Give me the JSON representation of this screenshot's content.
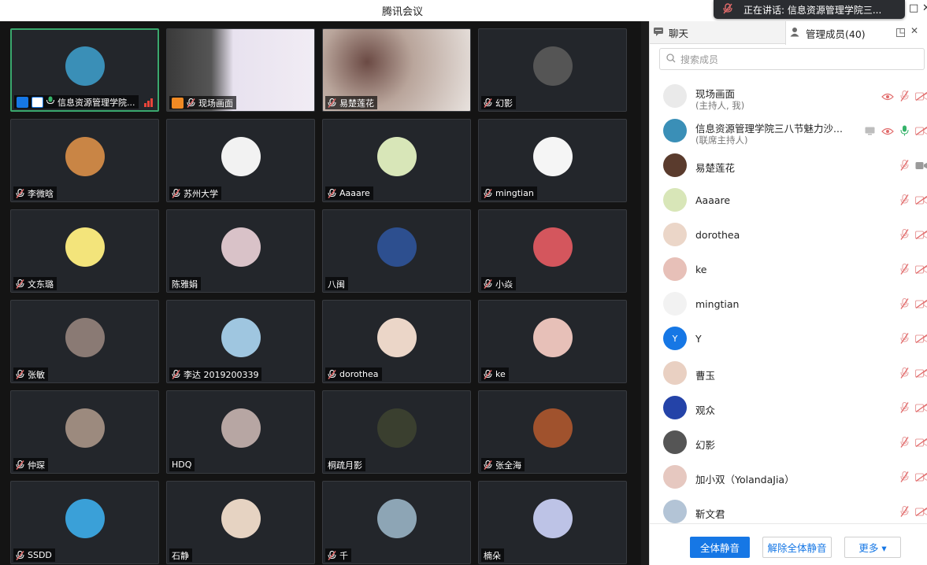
{
  "window": {
    "title": "腾讯会议",
    "speaking_banner": "正在讲话: 信息资源管理学院三..."
  },
  "grid": [
    {
      "name": "信息资源管理学院...",
      "muted": false,
      "active": true,
      "avatar_color": "#3a8fb7",
      "icon": "host-badges"
    },
    {
      "name": "现场画面",
      "muted": true,
      "active": false,
      "avatar_color": "#c9c9cf",
      "icon": "live-video"
    },
    {
      "name": "易楚莲花",
      "muted": true,
      "active": false,
      "avatar_color": "#b9a59b",
      "icon": "camera-video"
    },
    {
      "name": "幻影",
      "muted": true,
      "active": false,
      "avatar_color": "#555555"
    },
    {
      "name": "李微晗",
      "muted": true,
      "active": false,
      "avatar_color": "#c98545"
    },
    {
      "name": "苏州大学",
      "muted": true,
      "active": false,
      "avatar_color": "#f2f2f2"
    },
    {
      "name": "Aaaare",
      "muted": true,
      "active": false,
      "avatar_color": "#d8e6b8"
    },
    {
      "name": "mingtian",
      "muted": true,
      "active": false,
      "avatar_color": "#f5f5f5"
    },
    {
      "name": "文东璐",
      "muted": true,
      "active": false,
      "avatar_color": "#f3e47b"
    },
    {
      "name": "陈雅娟",
      "muted": false,
      "active": false,
      "avatar_color": "#d9c2c8"
    },
    {
      "name": "八闽",
      "muted": false,
      "active": false,
      "avatar_color": "#2d4f8f"
    },
    {
      "name": "小焱",
      "muted": true,
      "active": false,
      "avatar_color": "#d4565d"
    },
    {
      "name": "张敏",
      "muted": true,
      "active": false,
      "avatar_color": "#8a7a74"
    },
    {
      "name": "李达 2019200339",
      "muted": true,
      "active": false,
      "avatar_color": "#9fc6e0"
    },
    {
      "name": "dorothea",
      "muted": true,
      "active": false,
      "avatar_color": "#ebd6c8"
    },
    {
      "name": "ke",
      "muted": true,
      "active": false,
      "avatar_color": "#e7c0b8"
    },
    {
      "name": "仲琛",
      "muted": true,
      "active": false,
      "avatar_color": "#9c8a7e"
    },
    {
      "name": "HDQ",
      "muted": false,
      "active": false,
      "avatar_color": "#b7a6a3"
    },
    {
      "name": "桐疏月影",
      "muted": false,
      "active": false,
      "avatar_color": "#3a3f2f"
    },
    {
      "name": "张全海",
      "muted": true,
      "active": false,
      "avatar_color": "#a0522d"
    },
    {
      "name": "SSDD",
      "muted": true,
      "active": false,
      "avatar_color": "#3aa0d8"
    },
    {
      "name": "石静",
      "muted": false,
      "active": false,
      "avatar_color": "#e6d3c2"
    },
    {
      "name": "千",
      "muted": true,
      "active": false,
      "avatar_color": "#8da5b5"
    },
    {
      "name": "楠朵",
      "muted": false,
      "active": false,
      "avatar_color": "#bdc3e6"
    }
  ],
  "panel": {
    "tab_chat": "聊天",
    "tab_members": "管理成员(40)",
    "search_placeholder": "搜索成员",
    "members": [
      {
        "name": "现场画面",
        "role": "(主持人, 我)",
        "avatar_color": "#eaeaea",
        "mic": "off",
        "video": "off",
        "view": true,
        "share": false
      },
      {
        "name": "信息资源管理学院三八节魅力沙...",
        "role": "(联席主持人)",
        "avatar_color": "#3a8fb7",
        "mic": "on",
        "video": "off",
        "view": true,
        "share": true
      },
      {
        "name": "易楚莲花",
        "role": "",
        "avatar_color": "#5a3b2d",
        "mic": "off",
        "video": "on",
        "view": false,
        "share": false
      },
      {
        "name": "Aaaare",
        "role": "",
        "avatar_color": "#d8e6b8",
        "mic": "off",
        "video": "off",
        "view": false,
        "share": false
      },
      {
        "name": "dorothea",
        "role": "",
        "avatar_color": "#ebd6c8",
        "mic": "off",
        "video": "off",
        "view": false,
        "share": false
      },
      {
        "name": "ke",
        "role": "",
        "avatar_color": "#e7c0b8",
        "mic": "off",
        "video": "off",
        "view": false,
        "share": false
      },
      {
        "name": "mingtian",
        "role": "",
        "avatar_color": "#f2f2f2",
        "mic": "off",
        "video": "off",
        "view": false,
        "share": false
      },
      {
        "name": "Y",
        "role": "",
        "avatar_color": "#1677e5",
        "avatar_letter": "Y",
        "mic": "off",
        "video": "off",
        "view": false,
        "share": false
      },
      {
        "name": "曹玉",
        "role": "",
        "avatar_color": "#e9d0c2",
        "mic": "off",
        "video": "off",
        "view": false,
        "share": false
      },
      {
        "name": "观众",
        "role": "",
        "avatar_color": "#2443a8",
        "mic": "off",
        "video": "off",
        "view": false,
        "share": false
      },
      {
        "name": "幻影",
        "role": "",
        "avatar_color": "#555555",
        "mic": "off",
        "video": "off",
        "view": false,
        "share": false
      },
      {
        "name": "加小双（YolandaJia）",
        "role": "",
        "avatar_color": "#e6c8c0",
        "mic": "off",
        "video": "off",
        "view": false,
        "share": false
      },
      {
        "name": "靳文君",
        "role": "",
        "avatar_color": "#b3c4d6",
        "mic": "off",
        "video": "off",
        "view": false,
        "share": false
      }
    ],
    "btn_mute_all": "全体静音",
    "btn_unmute_all": "解除全体静音",
    "btn_more": "更多 ▾"
  },
  "colors": {
    "primary": "#1677e5",
    "muted_icon": "#e16a6a",
    "active_border": "#3aa76d",
    "mic_on": "#35b36a"
  }
}
